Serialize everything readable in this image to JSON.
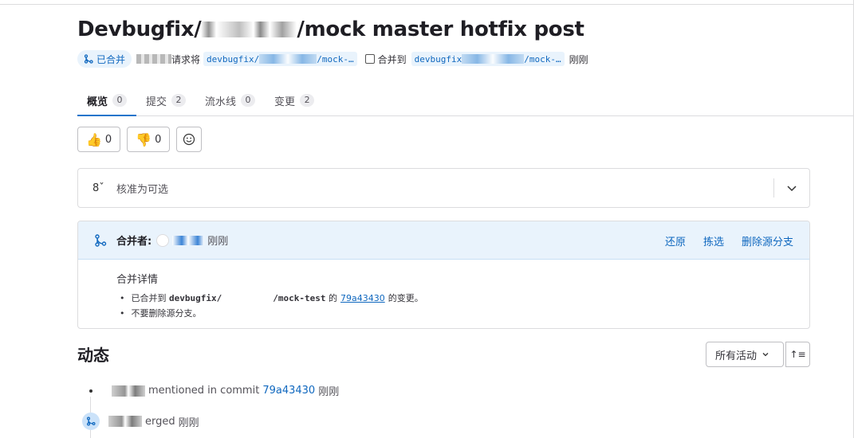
{
  "page": {
    "title_prefix": "Devbugfix/",
    "title_suffix": "/mock master hotfix post"
  },
  "meta": {
    "status_badge": "已合并",
    "request_text": "请求将",
    "source_branch_prefix": "devbugfix/",
    "source_branch_suffix": "/mock-…",
    "merge_into_text": "合并到",
    "target_branch_prefix": "devbugfix",
    "target_branch_suffix": "/mock-…",
    "time": "刚刚"
  },
  "tabs": [
    {
      "label": "概览",
      "count": "0"
    },
    {
      "label": "提交",
      "count": "2"
    },
    {
      "label": "流水线",
      "count": "0"
    },
    {
      "label": "变更",
      "count": "2"
    }
  ],
  "reactions": {
    "thumbs_up_count": "0",
    "thumbs_down_count": "0"
  },
  "approval": {
    "icon_text": "8",
    "label": "核准为可选"
  },
  "merged": {
    "merged_by_label": "合并者:",
    "time": "刚刚",
    "actions": {
      "revert": "还原",
      "cherry_pick": "拣选",
      "delete_branch": "删除源分支"
    },
    "details_heading": "合并详情",
    "detail1_prefix": "已合并到",
    "detail1_branch_a": "devbugfix/",
    "detail1_branch_b": "/mock-test",
    "detail1_of": "的",
    "detail1_commit": "79a43430",
    "detail1_suffix": "的变更。",
    "detail2": "不要删除源分支。"
  },
  "activity": {
    "title": "动态",
    "filter_label": "所有活动",
    "items": [
      {
        "text_a": "mentioned in commit",
        "commit": "79a43430",
        "time": "刚刚"
      },
      {
        "text_a": "erged",
        "time": "刚刚"
      }
    ]
  },
  "colors": {
    "accent": "#1068bf",
    "merged_bg": "#e9f3fc",
    "border": "#dcdcde"
  }
}
